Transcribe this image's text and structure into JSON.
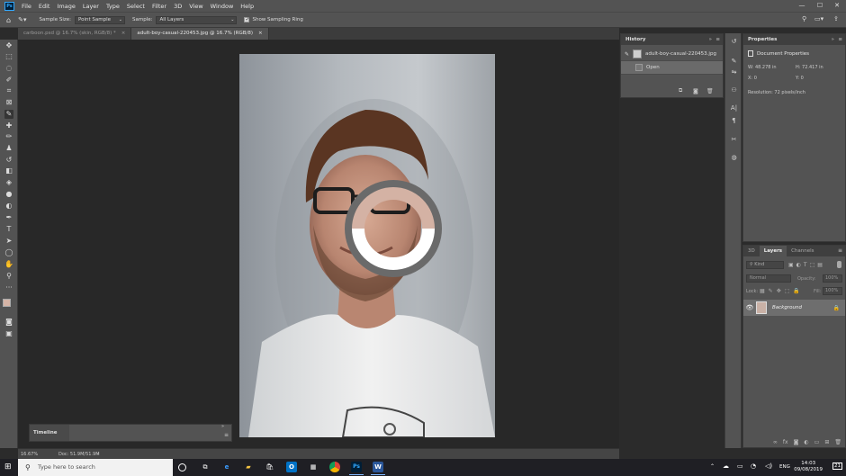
{
  "app": {
    "logo": "Ps"
  },
  "menu": [
    "File",
    "Edit",
    "Image",
    "Layer",
    "Type",
    "Select",
    "Filter",
    "3D",
    "View",
    "Window",
    "Help"
  ],
  "window_controls": {
    "minimize": "—",
    "maximize": "☐",
    "close": "✕"
  },
  "options": {
    "sample_size_label": "Sample Size:",
    "sample_size_value": "Point Sample",
    "sample_label": "Sample:",
    "sample_value": "All Layers",
    "sampling_ring_label": "Show Sampling Ring",
    "sampling_ring_checked": true
  },
  "doc_tabs": [
    {
      "label": "carboon.psd @ 16.7% (skin, RGB/8) *",
      "close": "×"
    },
    {
      "label": "adult-boy-casual-220453.jpg @ 16.7% (RGB/8)",
      "close": "×"
    }
  ],
  "eyedropper_ring": {
    "current_color": "#d4b2a4",
    "previous_color": "#ffffff",
    "outer_color": "#6a6a6a"
  },
  "colors": {
    "foreground": "#d6b4a6",
    "background": "#1a1a1a",
    "accent": "#31a8ff"
  },
  "timeline": {
    "title": "Timeline"
  },
  "status": {
    "zoom": "16.67%",
    "doc": "Doc: 51.9M/51.9M"
  },
  "history": {
    "title": "History",
    "items": [
      {
        "label": "adult-boy-casual-220453.jpg"
      },
      {
        "label": "Open"
      }
    ]
  },
  "properties": {
    "title": "Properties",
    "section": "Document Properties",
    "w_label": "W:",
    "w_value": "48.278 in",
    "h_label": "H:",
    "h_value": "72.417 in",
    "x_label": "X:",
    "x_value": "0",
    "y_label": "Y:",
    "y_value": "0",
    "resolution": "Resolution: 72 pixels/inch"
  },
  "layers": {
    "tabs": [
      "3D",
      "Layers",
      "Channels"
    ],
    "kind": "Kind",
    "blend_mode": "Normal",
    "opacity_label": "Opacity:",
    "opacity_value": "100%",
    "lock_label": "Lock:",
    "fill_label": "Fill:",
    "fill_value": "100%",
    "layer_name": "Background"
  },
  "taskbar": {
    "search_placeholder": "Type here to search",
    "lang": "ENG",
    "time": "14:03",
    "date": "09/08/2019",
    "notifications": "21"
  }
}
